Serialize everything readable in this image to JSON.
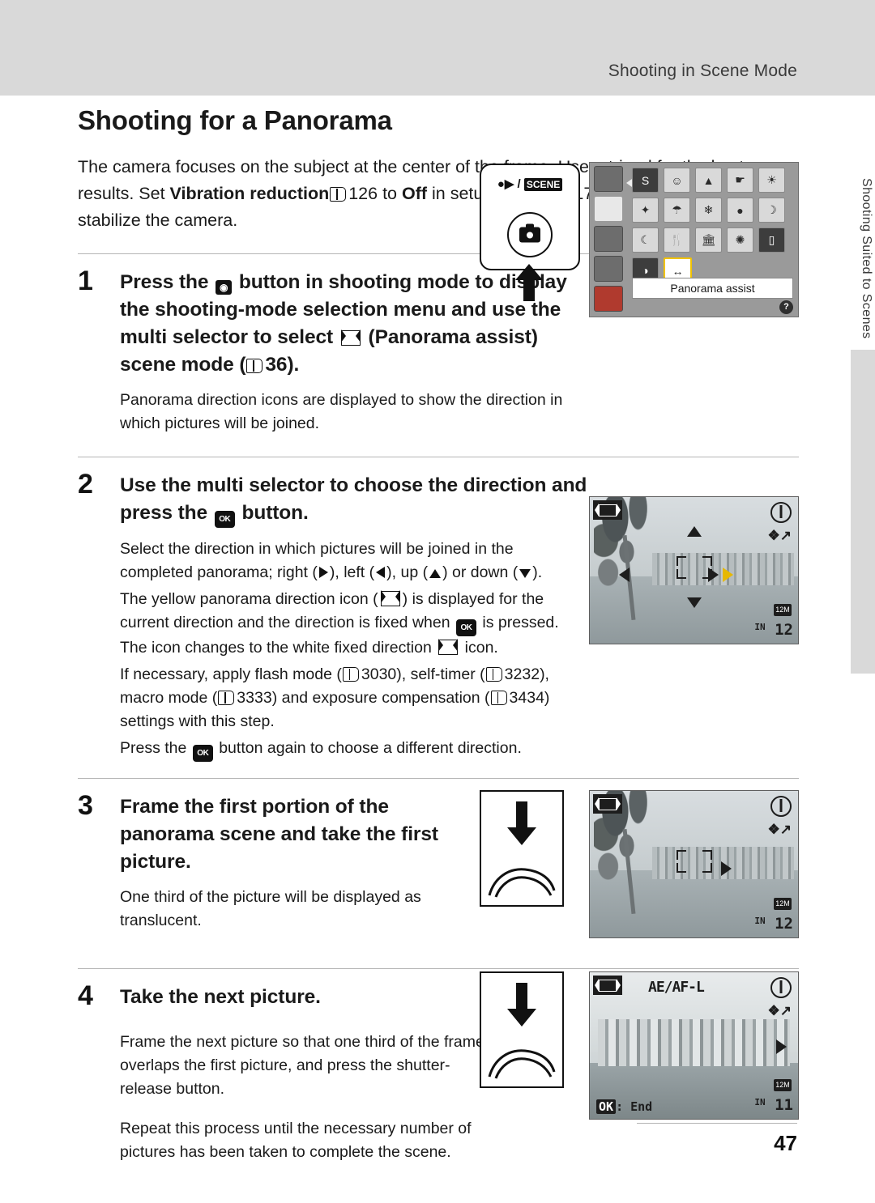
{
  "header": {
    "running_title": "Shooting in Scene Mode"
  },
  "side_tab": {
    "label": "Shooting Suited to Scenes"
  },
  "page": {
    "number": "47"
  },
  "title": "Shooting for a Panorama",
  "intro": {
    "part1": "The camera focuses on the subject at the center of the frame. Use a tripod for the best results. Set ",
    "bold1": "Vibration reduction",
    "ref1": "126",
    "part2": " to ",
    "bold2": "Off",
    "part3": " in setup menu ",
    "ref2": "117",
    "part4": " when using a tripod to stabilize the camera."
  },
  "steps": [
    {
      "number": "1",
      "heading_a": "Press the ",
      "heading_b": " button in shooting mode to display the shooting-mode selection menu and use the multi selector to select ",
      "heading_c": " (Panorama assist) scene mode (",
      "heading_ref": "36",
      "heading_d": ").",
      "body": [
        "Panorama direction icons are displayed to show the direction in which pictures will be joined."
      ]
    },
    {
      "number": "2",
      "heading_a": "Use the multi selector to choose the direction and press the ",
      "heading_b": " button.",
      "body_lines": [
        "Select the direction in which pictures will be joined in the completed panorama; right (",
        "), left (",
        "), up (",
        ") or down (",
        ").",
        "The yellow panorama direction icon (",
        ") is displayed for the current direction and the direction is fixed when ",
        " is pressed. The icon changes to the white fixed direction ",
        " icon.",
        "If necessary, apply flash mode (",
        "30), self-timer (",
        "32), macro mode (",
        "33) and exposure compensation (",
        "34) settings with this step.",
        "Press the ",
        " button again to choose a different direction."
      ],
      "refs": {
        "flash": "30",
        "timer": "32",
        "macro": "33",
        "exposure": "34"
      }
    },
    {
      "number": "3",
      "heading": "Frame the first portion of the panorama scene and take the first picture.",
      "body": [
        "One third of the picture will be displayed as translucent."
      ]
    },
    {
      "number": "4",
      "heading": "Take the next picture.",
      "body": [
        "Frame the next picture so that one third of the frame overlaps the first picture, and press the shutter-release button.",
        "Repeat this process until the necessary number of pictures has been taken to complete the scene."
      ]
    }
  ],
  "figures": {
    "camera_button": {
      "mode_label_movie": "•▶",
      "mode_label_scene": "SCENE"
    },
    "menu_screen": {
      "caption": "Panorama assist",
      "help_badge": "?"
    },
    "lcd_step2": {
      "image_size": "12M",
      "frames_remaining": "12",
      "in_prefix": "IN"
    },
    "lcd_step3": {
      "image_size": "12M",
      "frames_remaining": "12",
      "in_prefix": "IN"
    },
    "lcd_step4": {
      "ae_af_lock": "AE/AF-L",
      "image_size": "12M",
      "frames_remaining": "11",
      "in_prefix": "IN",
      "end_hint_key": "OK",
      "end_hint_text": ": End"
    }
  }
}
